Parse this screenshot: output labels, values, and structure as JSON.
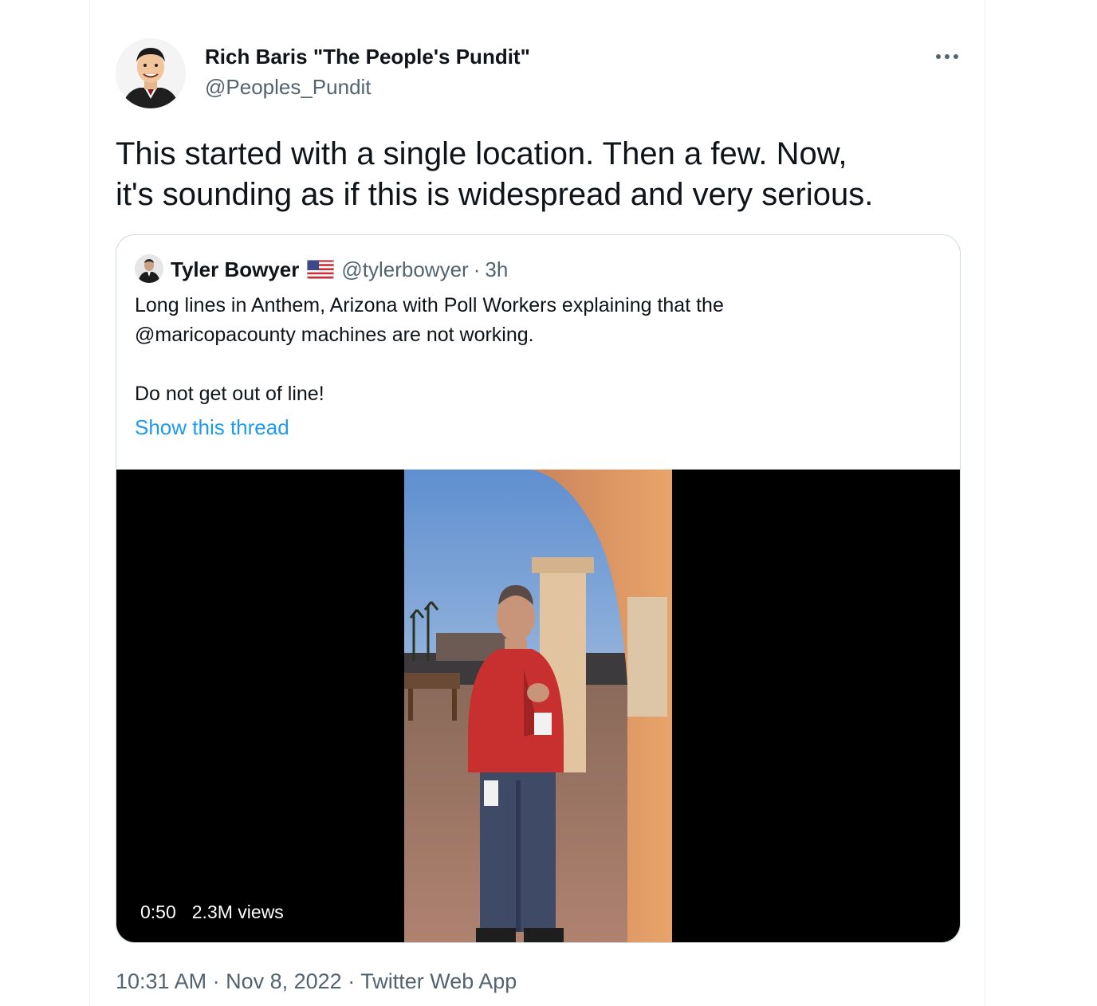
{
  "tweet": {
    "author_name": "Rich Baris \"The People's Pundit\"",
    "author_handle": "@Peoples_Pundit",
    "more_icon": "more-horizontal-icon",
    "text_lines": [
      "This started with a single location. Then a few. Now,",
      "it's sounding as if this is widespread and very serious."
    ]
  },
  "quote": {
    "author_name": "Tyler Bowyer",
    "flag_icon": "us-flag-icon",
    "handle": "@tylerbowyer",
    "separator": "·",
    "time": "3h",
    "text_lines": [
      "Long lines in Anthem, Arizona with Poll Workers explaining that the",
      "@maricopacounty machines are not working.",
      "",
      "Do not get out of line!"
    ],
    "show_thread": "Show this thread",
    "video": {
      "duration": "0:50",
      "views": "2.3M views"
    }
  },
  "footer": {
    "time": "10:31 AM",
    "sep1": " · ",
    "date": "Nov 8, 2022",
    "sep2": " · ",
    "source": "Twitter Web App"
  },
  "colors": {
    "link": "#1d9bf0",
    "secondary_text": "#536471",
    "primary_text": "#0f1419",
    "border": "#cfd9de"
  }
}
